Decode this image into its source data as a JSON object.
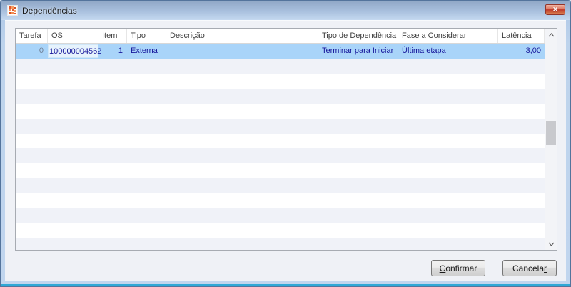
{
  "window": {
    "title": "Dependências",
    "close_glyph": "✕"
  },
  "table": {
    "columns": [
      {
        "id": "tarefa",
        "label": "Tarefa"
      },
      {
        "id": "os",
        "label": "OS"
      },
      {
        "id": "item",
        "label": "Item"
      },
      {
        "id": "tipo",
        "label": "Tipo"
      },
      {
        "id": "descricao",
        "label": "Descrição"
      },
      {
        "id": "tipo_de_dependencia",
        "label": "Tipo de Dependência"
      },
      {
        "id": "fase_a_considerar",
        "label": "Fase a Considerar"
      },
      {
        "id": "latencia",
        "label": "Latência"
      }
    ],
    "selected_row": {
      "tarefa": "0",
      "os": "100000004562",
      "item": "1",
      "tipo": "Externa",
      "descricao": "",
      "tipo_de_dependencia": "Terminar para Iniciar",
      "fase_a_considerar": "Última etapa",
      "latencia": "3,00"
    }
  },
  "buttons": {
    "confirmar": {
      "pre": "",
      "key": "C",
      "post": "onfirmar"
    },
    "cancelar": {
      "pre": "Cancela",
      "key": "r",
      "post": ""
    }
  },
  "colors": {
    "selection_bg": "#a9d4f9",
    "selection_text": "#16169a",
    "row_stripe": "#f0f2f8",
    "titlebar_top": "#90a7c6",
    "titlebar_bottom": "#c5d9f0",
    "close_button_red": "#c0392b",
    "bottom_accent": "#2fa8d6"
  }
}
